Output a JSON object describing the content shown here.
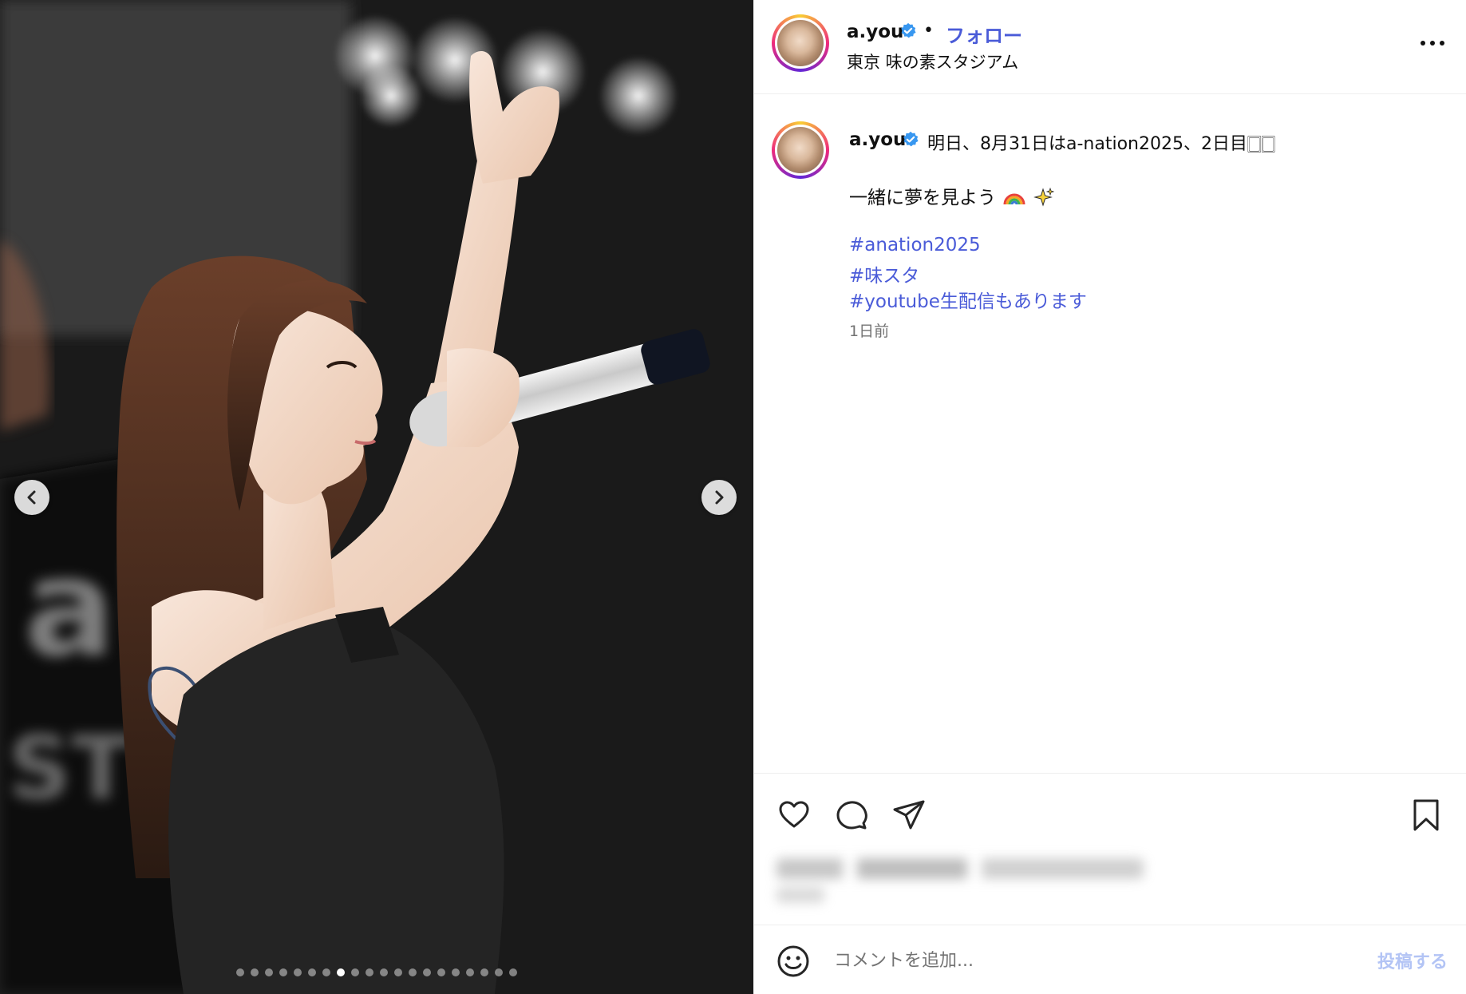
{
  "post": {
    "username": "a.you",
    "separator": "•",
    "follow_label": "フォロー",
    "location": "東京 味の素スタジアム",
    "caption_line1": "明日、8月31日はa-nation2025、2日目🀆🀆",
    "caption_line2": "一緒に夢を見よう",
    "hashtags": [
      "#anation2025",
      "#味スタ",
      "#youtube生配信もあります"
    ],
    "timestamp": "1日前"
  },
  "carousel": {
    "total": 20,
    "active_index": 7
  },
  "comment": {
    "placeholder": "コメントを追加...",
    "post_label": "投稿する"
  },
  "colors": {
    "accent": "#4a5bd8",
    "verified": "#3897f0",
    "post_disabled": "#b3c4f5"
  },
  "icons": [
    "verified-badge-icon",
    "more-options-icon",
    "heart-icon",
    "comment-icon",
    "share-icon",
    "bookmark-icon",
    "emoji-icon",
    "chevron-left-icon",
    "chevron-right-icon"
  ]
}
